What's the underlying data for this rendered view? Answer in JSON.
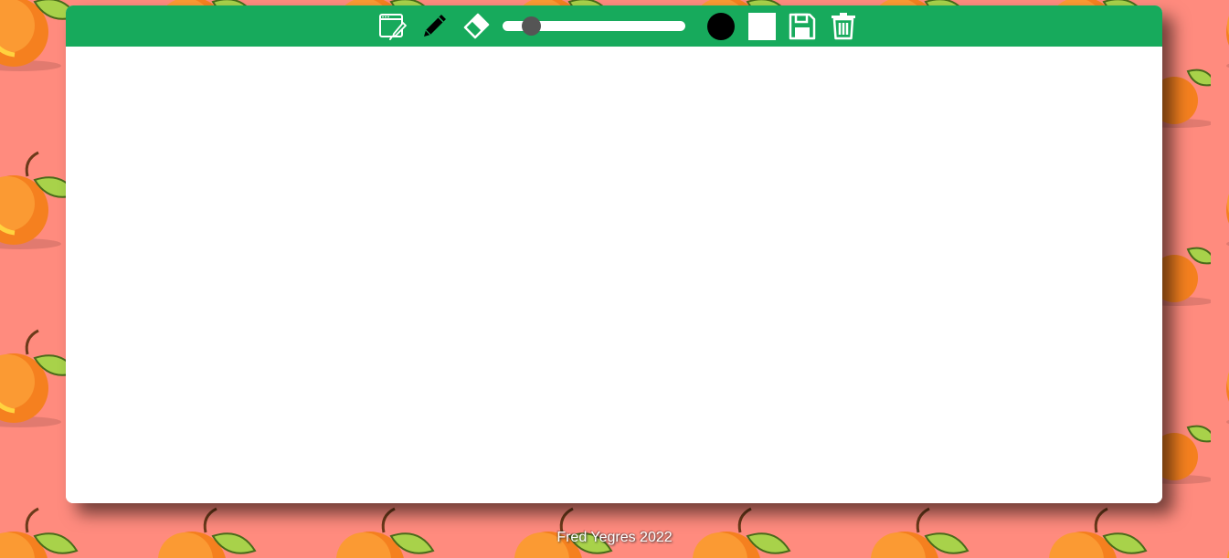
{
  "colors": {
    "background": "#ff8b7e",
    "toolbar": "#17aa5c",
    "board": "#ffffff",
    "brush_color": "#000000",
    "background_color": "#ffffff",
    "slider_track": "#ffffff",
    "slider_knob": "#555555"
  },
  "toolbar": {
    "tools": [
      {
        "name": "bucket-fill-icon"
      },
      {
        "name": "brush-icon"
      },
      {
        "name": "eraser-icon"
      },
      {
        "name": "save-icon"
      },
      {
        "name": "trash-icon"
      }
    ],
    "brush_size": {
      "value": 5,
      "min": 1,
      "max": 50
    }
  },
  "footer": {
    "text": "Fred Yegres 2022"
  }
}
